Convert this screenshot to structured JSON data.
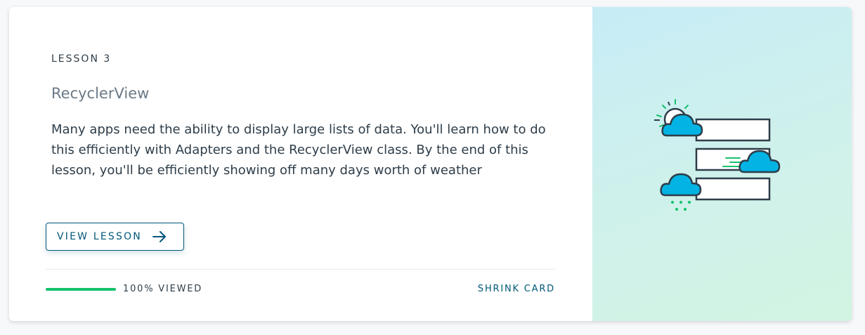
{
  "card": {
    "eyebrow": "LESSON 3",
    "title": "RecyclerView",
    "summary": "Many apps need the ability to display large lists of data. You'll learn how to do this efficiently with Adapters and the RecyclerView class. By the end of this lesson, you'll be efficiently showing off many days worth of weather",
    "view_button_label": "VIEW LESSON",
    "progress": {
      "percent": 100,
      "label": "100% VIEWED"
    },
    "shrink_label": "SHRINK CARD"
  },
  "icons": {
    "arrow": "arrow-right-icon",
    "illustration": "weather-list-illustration"
  },
  "colors": {
    "accent": "#02577a",
    "progress": "#15c26b",
    "text": "#2e3d49",
    "cloud": "#02b3e4"
  }
}
